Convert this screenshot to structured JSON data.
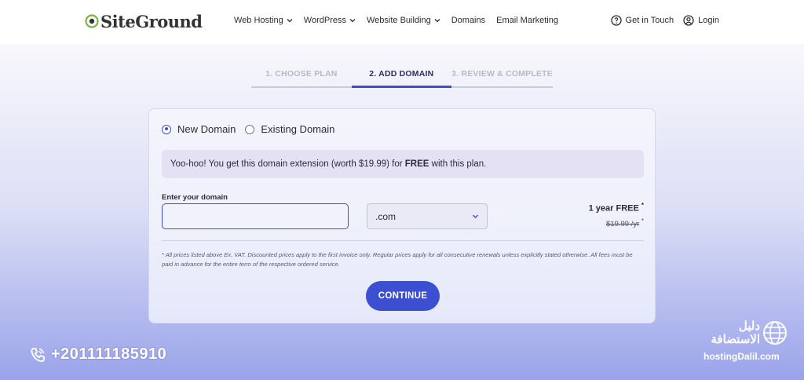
{
  "header": {
    "logo_text": "SiteGround",
    "nav": [
      {
        "label": "Web Hosting",
        "has_dropdown": true
      },
      {
        "label": "WordPress",
        "has_dropdown": true
      },
      {
        "label": "Website Building",
        "has_dropdown": true
      },
      {
        "label": "Domains",
        "has_dropdown": false
      },
      {
        "label": "Email Marketing",
        "has_dropdown": false
      }
    ],
    "get_in_touch": "Get in Touch",
    "login": "Login"
  },
  "steps": [
    {
      "label": "1. CHOOSE PLAN",
      "state": "done"
    },
    {
      "label": "2. ADD DOMAIN",
      "state": "active"
    },
    {
      "label": "3. REVIEW & COMPLETE",
      "state": "upcoming"
    }
  ],
  "domain_form": {
    "options": [
      {
        "label": "New Domain",
        "checked": true
      },
      {
        "label": "Existing Domain",
        "checked": false
      }
    ],
    "promo_prefix": "Yoo-hoo! You get this domain extension (worth $19.99) for ",
    "promo_bold": "FREE",
    "promo_suffix": " with this plan.",
    "field_label": "Enter your domain",
    "input_value": "",
    "tld_selected": ".com",
    "price_free": "1 year FREE",
    "price_old": "$19.99 /yr",
    "asterisk": "*",
    "disclaimer": "* All prices listed above Ex. VAT. Discounted prices apply to the first invoice only. Regular prices apply for all consecutive renewals unless explicitly stated otherwise. All fees must be paid in advance for the entire term of the respective ordered service.",
    "continue_label": "CONTINUE"
  },
  "overlay": {
    "phone": "+201111185910",
    "watermark_arabic_top": "دليل",
    "watermark_arabic_bottom": "الاستضافة",
    "watermark_url": "hostingDalil.com"
  },
  "colors": {
    "accent": "#3d4fd1",
    "promo_bg": "#e4e1f5",
    "logo_green": "#7cb342"
  }
}
